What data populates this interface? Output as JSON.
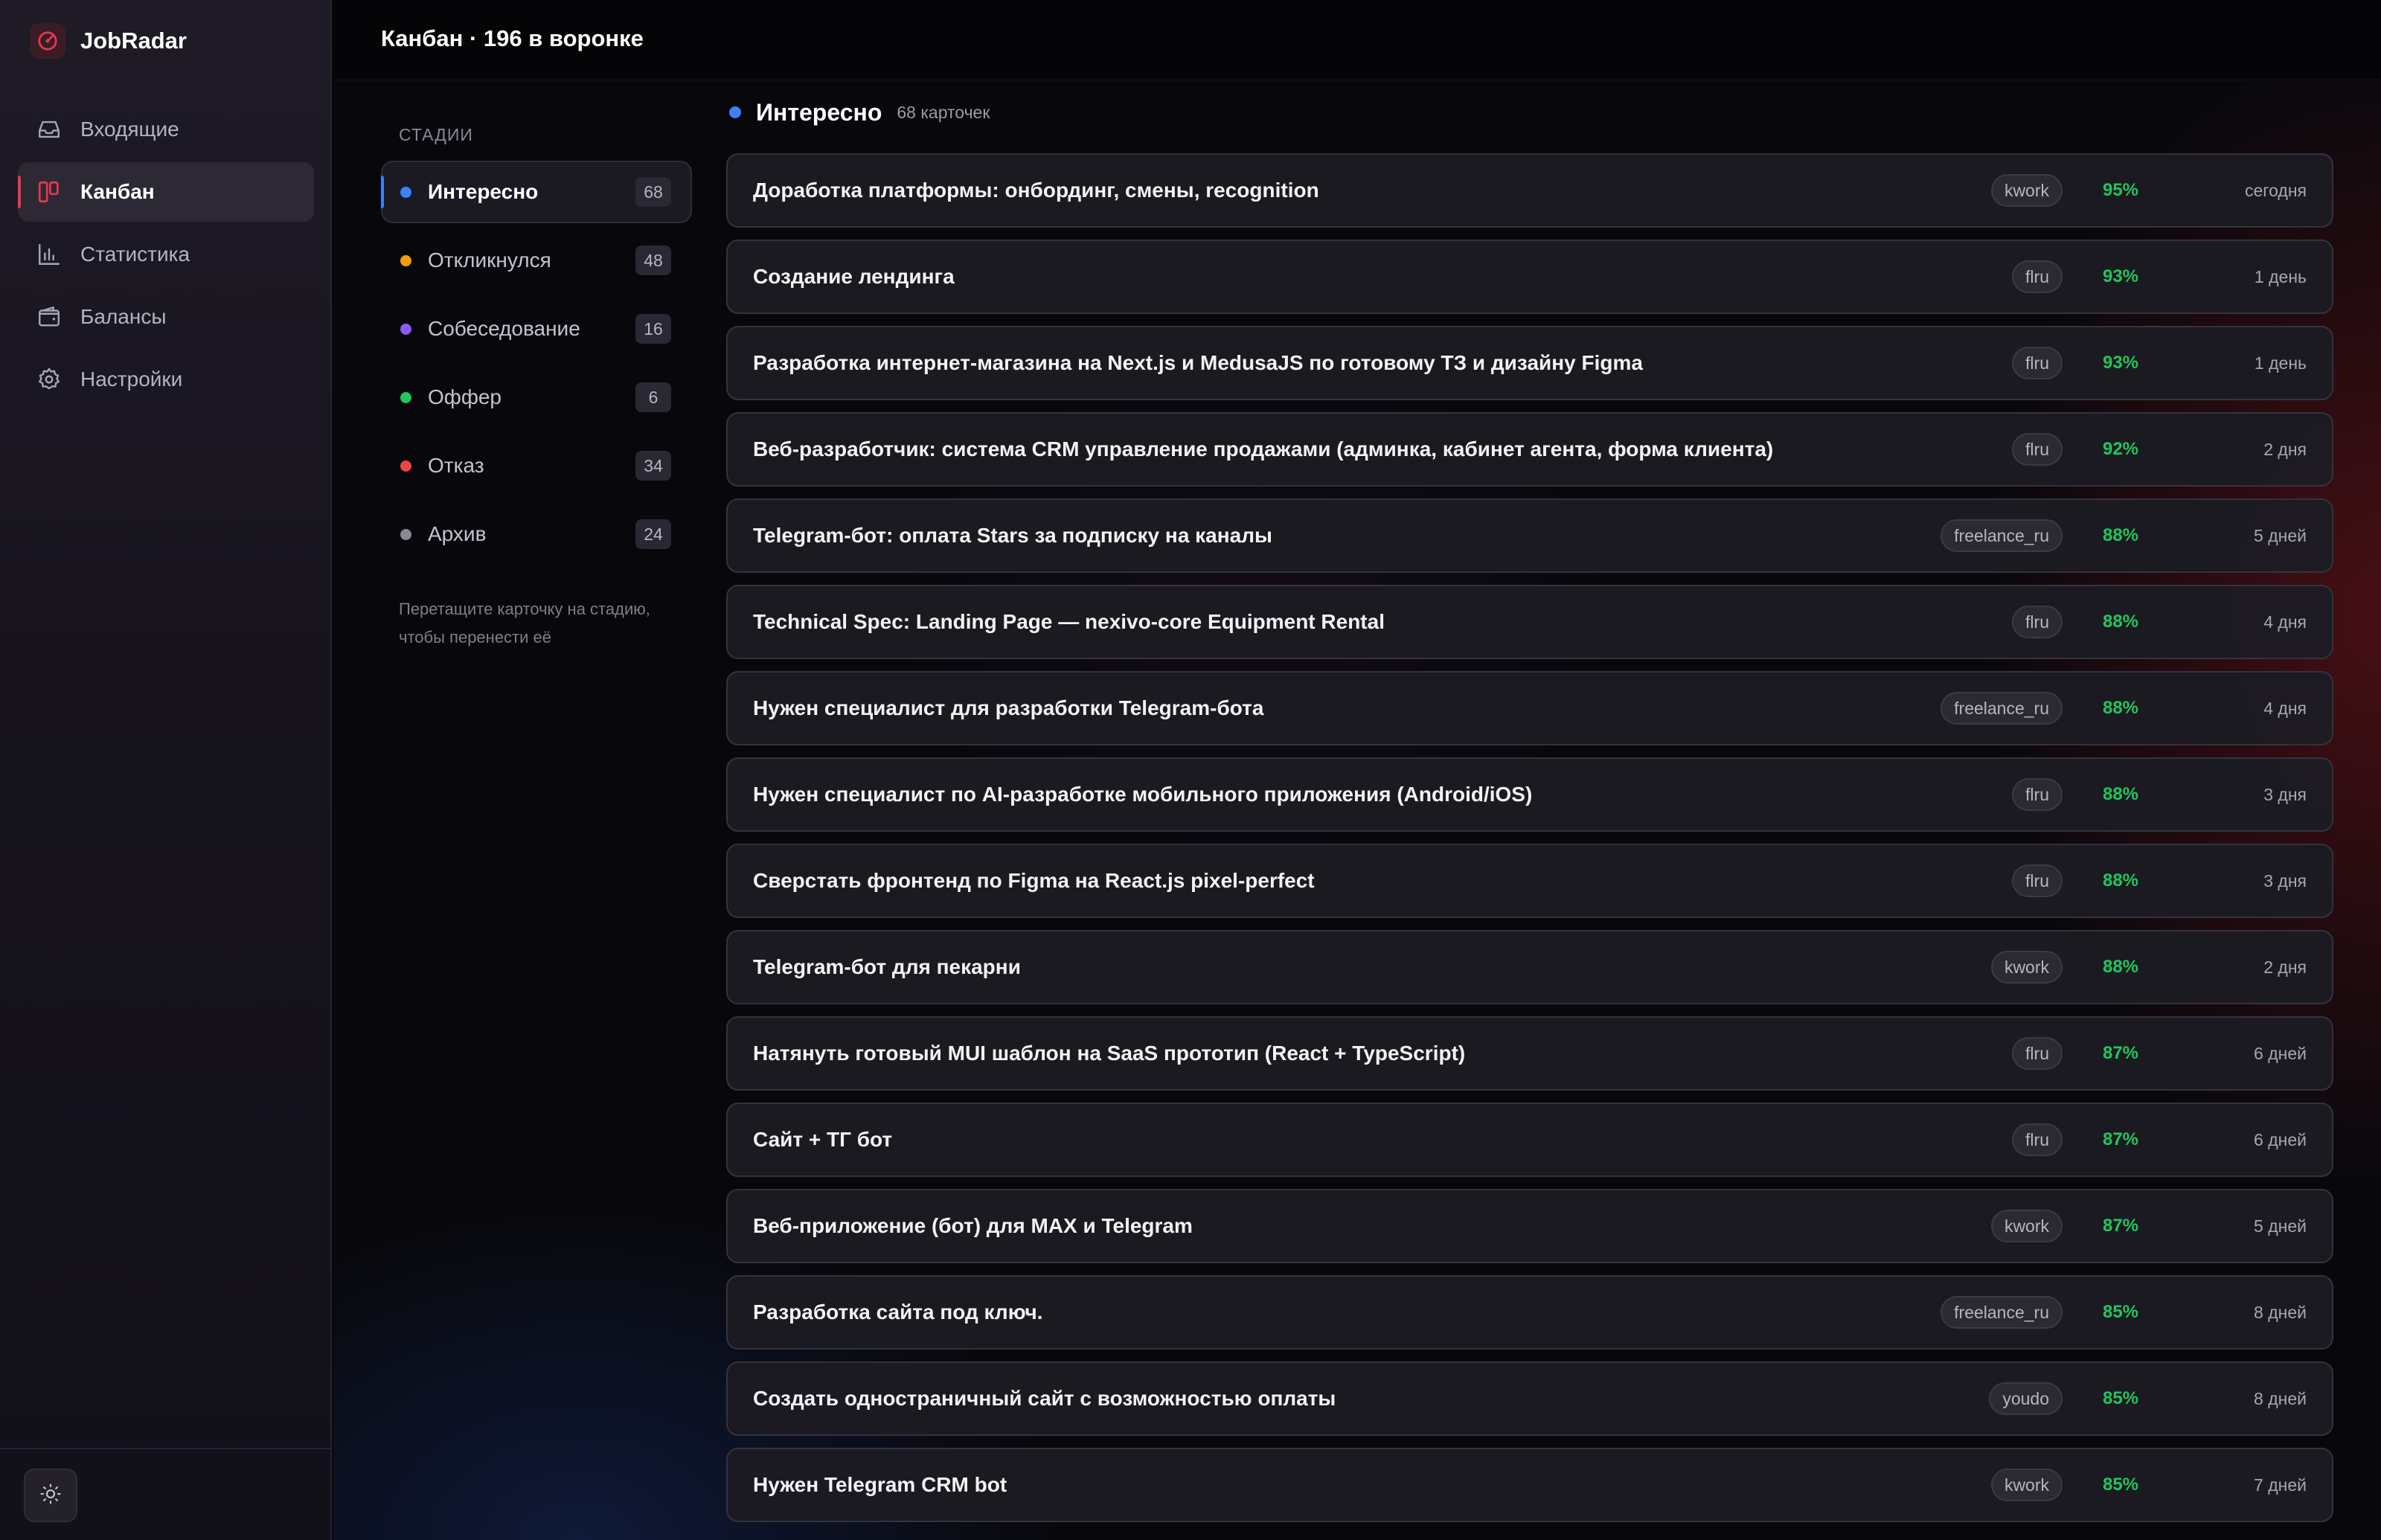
{
  "app": {
    "name": "JobRadar"
  },
  "nav": [
    {
      "label": "Входящие",
      "icon": "inbox-icon",
      "active": false
    },
    {
      "label": "Канбан",
      "icon": "kanban-icon",
      "active": true
    },
    {
      "label": "Статистика",
      "icon": "bar-chart-icon",
      "active": false
    },
    {
      "label": "Балансы",
      "icon": "wallet-icon",
      "active": false
    },
    {
      "label": "Настройки",
      "icon": "gear-icon",
      "active": false
    }
  ],
  "header": {
    "title": "Канбан · 196 в воронке"
  },
  "stages": {
    "heading": "СТАДИИ",
    "items": [
      {
        "label": "Интересно",
        "count": "68",
        "color": "#3b82f6",
        "active": true
      },
      {
        "label": "Откликнулся",
        "count": "48",
        "color": "#f59e0b",
        "active": false
      },
      {
        "label": "Собеседование",
        "count": "16",
        "color": "#8b5cf6",
        "active": false
      },
      {
        "label": "Оффер",
        "count": "6",
        "color": "#22c55e",
        "active": false
      },
      {
        "label": "Отказ",
        "count": "34",
        "color": "#ef4444",
        "active": false
      },
      {
        "label": "Архив",
        "count": "24",
        "color": "#8a8896",
        "active": false
      }
    ],
    "hint": "Перетащите карточку на стадию, чтобы перенести её"
  },
  "column": {
    "title": "Интересно",
    "subtitle": "68 карточек",
    "color": "#3b82f6",
    "cards": [
      {
        "title": "Доработка платформы: онбординг, смены, recognition",
        "source": "kwork",
        "score": "95%",
        "time": "сегодня"
      },
      {
        "title": "Создание лендинга",
        "source": "flru",
        "score": "93%",
        "time": "1 день"
      },
      {
        "title": "Разработка интернет-магазина на Next.js и MedusaJS по готовому ТЗ и дизайну Figma",
        "source": "flru",
        "score": "93%",
        "time": "1 день"
      },
      {
        "title": "Веб-разработчик: система CRM управление продажами (админка, кабинет агента, форма клиента)",
        "source": "flru",
        "score": "92%",
        "time": "2 дня"
      },
      {
        "title": "Telegram-бот: оплата Stars за подписку на каналы",
        "source": "freelance_ru",
        "score": "88%",
        "time": "5 дней"
      },
      {
        "title": "Technical Spec: Landing Page — nexivo-core Equipment Rental",
        "source": "flru",
        "score": "88%",
        "time": "4 дня"
      },
      {
        "title": "Нужен специалист для разработки Telegram-бота",
        "source": "freelance_ru",
        "score": "88%",
        "time": "4 дня"
      },
      {
        "title": "Нужен специалист по AI-разработке мобильного приложения (Android/iOS)",
        "source": "flru",
        "score": "88%",
        "time": "3 дня"
      },
      {
        "title": "Сверстать фронтенд по Figma на React.js pixel-perfect",
        "source": "flru",
        "score": "88%",
        "time": "3 дня"
      },
      {
        "title": "Telegram-бот для пекарни",
        "source": "kwork",
        "score": "88%",
        "time": "2 дня"
      },
      {
        "title": "Натянуть готовый MUI шаблон на SaaS прототип (React + TypeScript)",
        "source": "flru",
        "score": "87%",
        "time": "6 дней"
      },
      {
        "title": "Сайт + ТГ бот",
        "source": "flru",
        "score": "87%",
        "time": "6 дней"
      },
      {
        "title": "Веб-приложение (бот) для MAX и Telegram",
        "source": "kwork",
        "score": "87%",
        "time": "5 дней"
      },
      {
        "title": "Разработка сайта под ключ.",
        "source": "freelance_ru",
        "score": "85%",
        "time": "8 дней"
      },
      {
        "title": "Создать одностраничный сайт с возможностью оплаты",
        "source": "youdo",
        "score": "85%",
        "time": "8 дней"
      },
      {
        "title": "Нужен Telegram CRM bot",
        "source": "kwork",
        "score": "85%",
        "time": "7 дней"
      }
    ]
  }
}
